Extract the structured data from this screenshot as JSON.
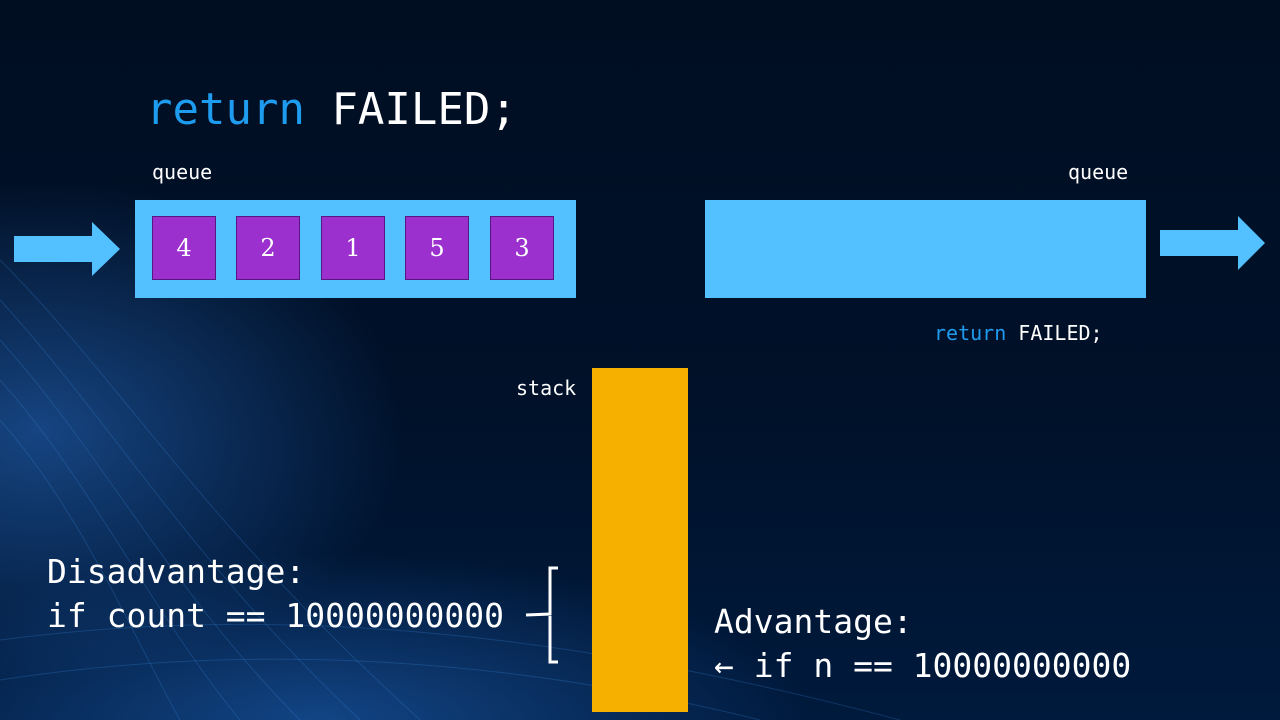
{
  "title": {
    "keyword": "return",
    "rest": " FAILED;"
  },
  "left_queue": {
    "label": "queue",
    "items": [
      "4",
      "2",
      "1",
      "5",
      "3"
    ]
  },
  "right_queue": {
    "label": "queue",
    "code_keyword": "return",
    "code_rest": " FAILED;"
  },
  "stack": {
    "label": "stack"
  },
  "disadvantage": {
    "heading": "Disadvantage:",
    "line": "if count == 10000000000"
  },
  "advantage": {
    "heading": "Advantage:",
    "line": "← if n == 10000000000"
  },
  "colors": {
    "background": "#000f22",
    "queue": "#53c1ff",
    "item": "#9b30cf",
    "stack": "#f6b100",
    "keyword": "#1e9cf0",
    "text": "#ffffff"
  }
}
